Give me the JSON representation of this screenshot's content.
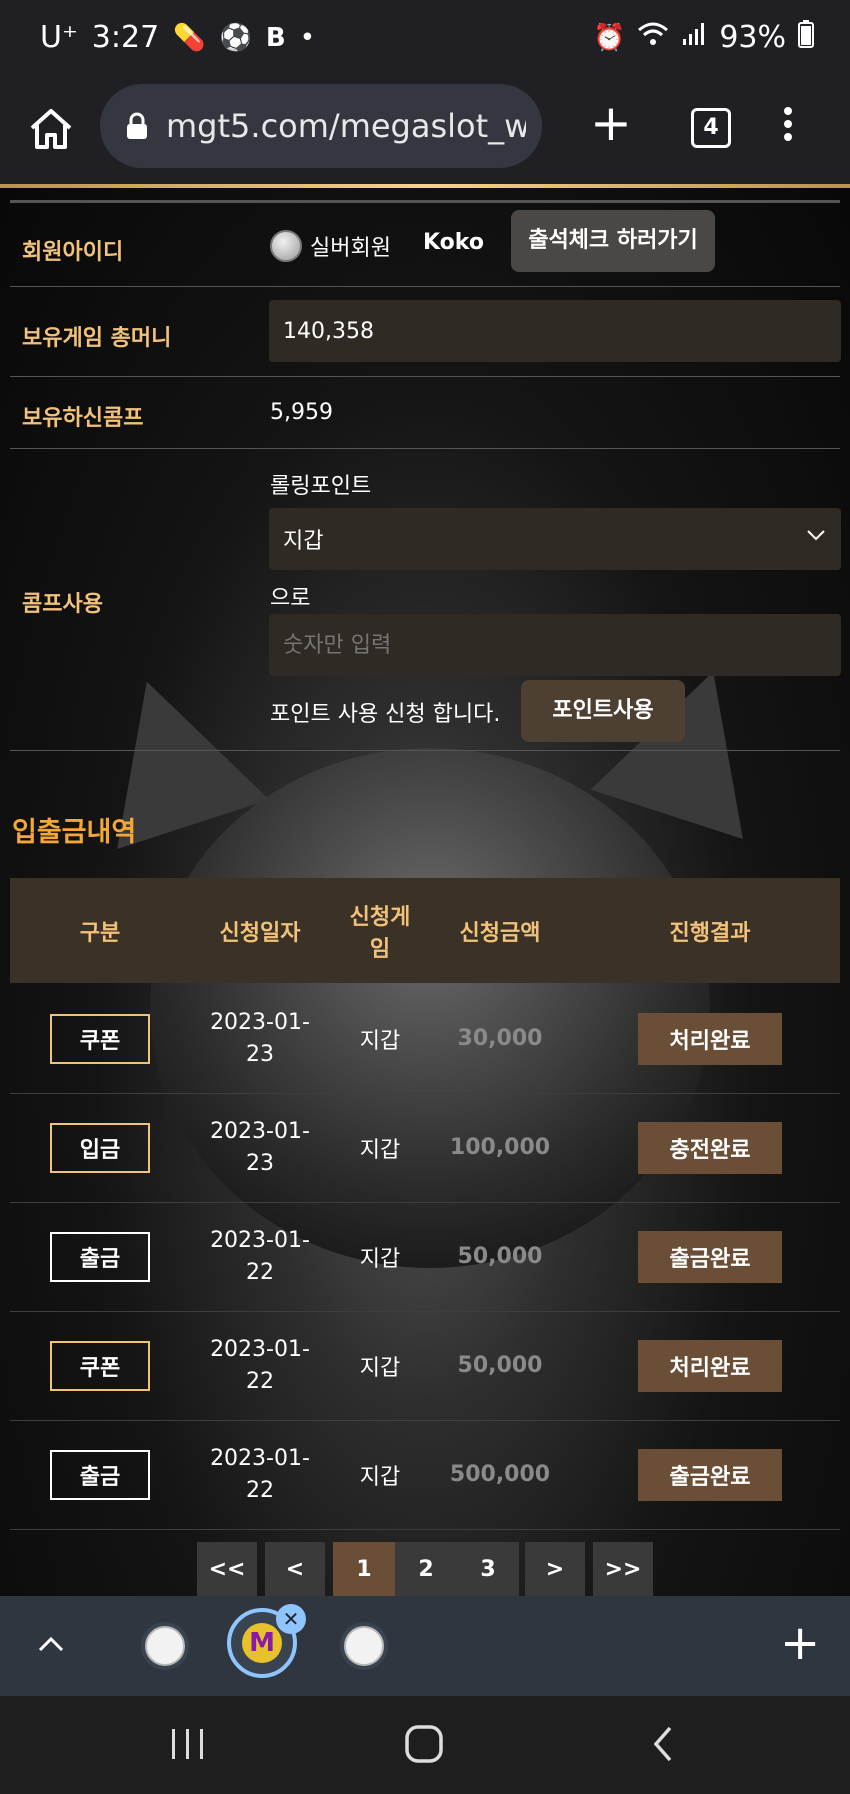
{
  "status_bar": {
    "carrier": "U⁺",
    "time": "3:27",
    "battery": "93%"
  },
  "browser": {
    "url": "mgt5.com/megaslot_wa",
    "tab_count": "4"
  },
  "member": {
    "id_label": "회원아이디",
    "grade": "실버회원",
    "name": "Koko",
    "attendance_button": "출석체크 하러가기",
    "money_label": "보유게임 총머니",
    "money_value": "140,358",
    "comp_label": "보유하신콤프",
    "comp_value": "5,959"
  },
  "comp_use": {
    "label": "콤프사용",
    "rolling_point_label": "롤링포인트",
    "wallet_select": "지갑",
    "to_label": "으로",
    "amount_placeholder": "숫자만 입력",
    "request_text": "포인트 사용 신청 합니다.",
    "use_button": "포인트사용"
  },
  "history": {
    "title": "입출금내역",
    "headers": [
      "구분",
      "신청일자",
      "신청게임",
      "신청금액",
      "진행결과"
    ],
    "rows": [
      {
        "type": "쿠폰",
        "date": "2023-01-23",
        "game": "지갑",
        "amount": "30,000",
        "result": "처리완료",
        "type_color": "#f2c27a"
      },
      {
        "type": "입금",
        "date": "2023-01-23",
        "game": "지갑",
        "amount": "100,000",
        "result": "충전완료",
        "type_color": "#f2c27a"
      },
      {
        "type": "출금",
        "date": "2023-01-22",
        "game": "지갑",
        "amount": "50,000",
        "result": "출금완료",
        "type_color": "#ffffff"
      },
      {
        "type": "쿠폰",
        "date": "2023-01-22",
        "game": "지갑",
        "amount": "50,000",
        "result": "처리완료",
        "type_color": "#f2c27a"
      },
      {
        "type": "출금",
        "date": "2023-01-22",
        "game": "지갑",
        "amount": "500,000",
        "result": "출금완료",
        "type_color": "#ffffff"
      }
    ]
  },
  "pagination": {
    "first": "<<",
    "prev": "<",
    "pages": [
      "1",
      "2",
      "3"
    ],
    "current": "1",
    "next": ">",
    "last": ">>"
  },
  "colors": {
    "accent_gold": "#f2c27a",
    "title_orange": "#f4a736",
    "result_brown": "#6a4f36"
  }
}
